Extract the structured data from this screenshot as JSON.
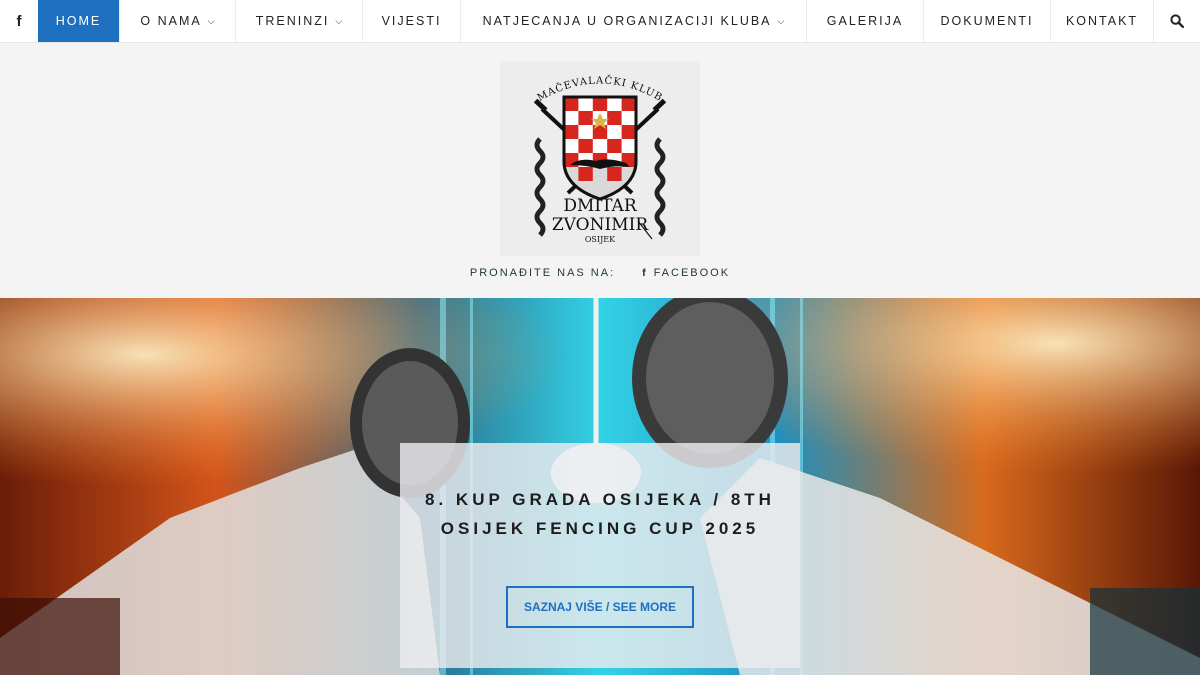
{
  "nav": {
    "facebook_glyph": "f",
    "items": [
      {
        "label": "HOME",
        "active": true,
        "dropdown": false
      },
      {
        "label": "O NAMA",
        "active": false,
        "dropdown": true
      },
      {
        "label": "TRENINZI",
        "active": false,
        "dropdown": true
      },
      {
        "label": "VIJESTI",
        "active": false,
        "dropdown": false
      },
      {
        "label": "NATJECANJA U ORGANIZACIJI KLUBA",
        "active": false,
        "dropdown": true
      },
      {
        "label": "GALERIJA",
        "active": false,
        "dropdown": false
      },
      {
        "label": "DOKUMENTI",
        "active": false,
        "dropdown": false
      },
      {
        "label": "KONTAKT",
        "active": false,
        "dropdown": false
      }
    ],
    "search_icon": "search-icon"
  },
  "logo": {
    "top_text": "MAČEVALAČKI KLUB",
    "line1": "DMITAR",
    "line2": "ZVONIMIR",
    "line3": "OSIJEK"
  },
  "social": {
    "label": "PRONAĐITE NAS NA:",
    "fb_glyph": "f",
    "facebook": "FACEBOOK"
  },
  "hero": {
    "title": "8. KUP GRADA OSIJEKA / 8TH OSIJEK FENCING CUP 2025",
    "button": "SAZNAJ VIŠE / SEE MORE"
  },
  "colors": {
    "accent": "#1f6fc0",
    "header_bg": "#f4f4f4",
    "checker_red": "#d7261e"
  }
}
